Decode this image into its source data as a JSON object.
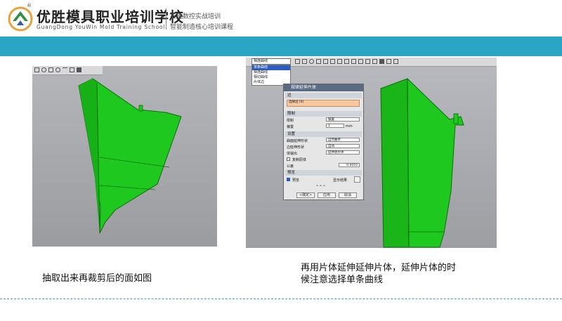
{
  "header": {
    "school_name": "优胜模具职业培训学校",
    "school_name_en": "GuangDong YouWin Mold Training School",
    "registered_mark": "®",
    "slogan_line1": "五轴数控实战培训",
    "slogan_line2": "智能制造核心培训课程"
  },
  "colors": {
    "teal_bar": "#2aa6c4",
    "part_green": "#1ec81e",
    "dashed_line": "#3aa0d0"
  },
  "left_panel": {
    "caption": "抽取出来再裁剪后的面如图"
  },
  "right_panel": {
    "caption": "再用片体延伸延伸片体，延伸片体的时候注意选择单条曲线",
    "dropdown_value": "相连曲线",
    "dropdown_options": [
      "单条曲线",
      "相连曲线",
      "相切曲线",
      "片体边"
    ],
    "dialog": {
      "title": "规律延伸片体",
      "sec_edge": "边",
      "select_edge": "选择边 (0)",
      "sec_limit": "限制",
      "limit_label": "限制",
      "limit_value": "偏置",
      "offset_label": "偏置",
      "offset_value": "1",
      "offset_unit": "mm",
      "sec_settings": "设置",
      "set1_label": "曲面延伸形状",
      "set1_value": "自然曲率",
      "set2_label": "边延伸形状",
      "set2_value": "自动",
      "set3_label": "体输出",
      "set3_value": "延伸原片体",
      "copy_label": "复制原体",
      "tol_label": "公差",
      "tol_value": "0.0010",
      "sec_preview": "预览",
      "preview_label": "预览",
      "show_result": "显示结果",
      "ok": "<确定>",
      "apply": "应用",
      "cancel": "取消"
    }
  }
}
